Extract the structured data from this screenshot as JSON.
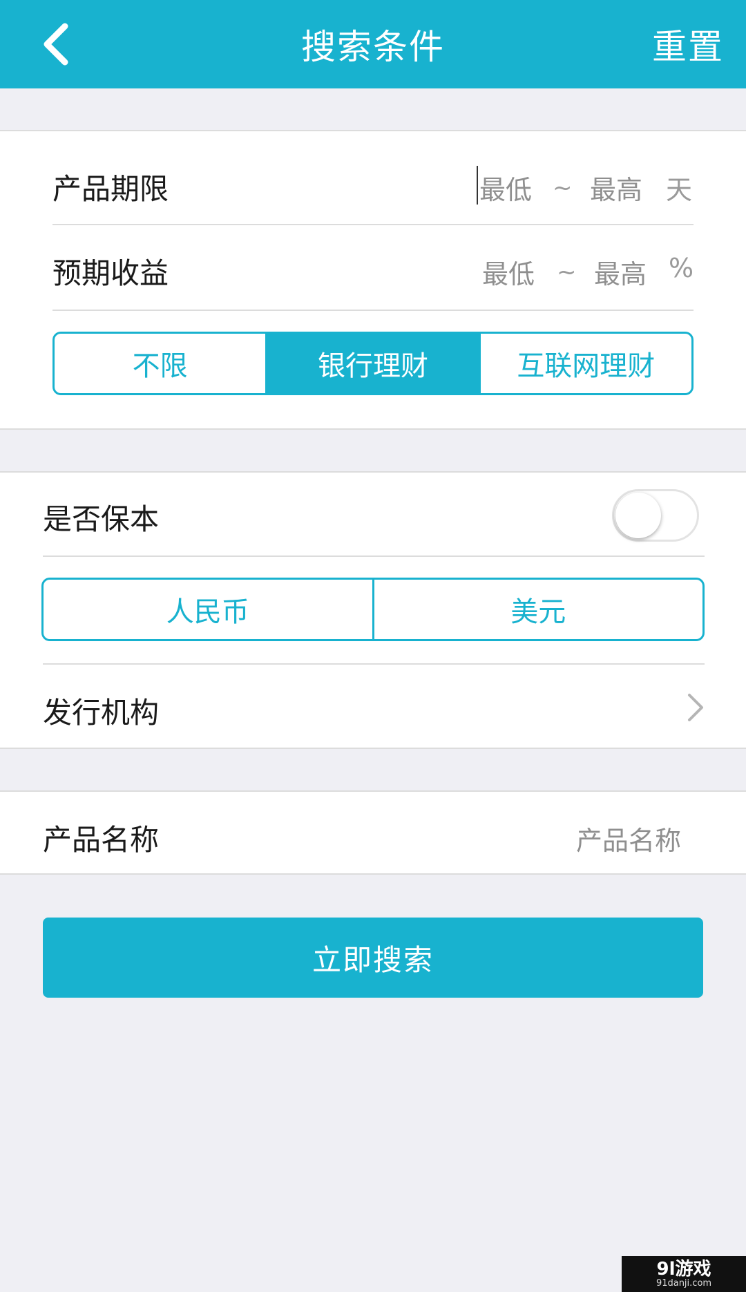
{
  "header": {
    "title": "搜索条件",
    "reset_label": "重置"
  },
  "term": {
    "label": "产品期限",
    "min_placeholder": "最低",
    "separator": "~",
    "max_placeholder": "最高",
    "unit": "天"
  },
  "yield": {
    "label": "预期收益",
    "min_placeholder": "最低",
    "separator": "~",
    "max_placeholder": "最高",
    "unit": "%"
  },
  "product_type": {
    "options": [
      "不限",
      "银行理财",
      "互联网理财"
    ],
    "selected": "银行理财"
  },
  "principal": {
    "label": "是否保本",
    "enabled": false
  },
  "currency": {
    "options": [
      "人民币",
      "美元"
    ]
  },
  "issuer": {
    "label": "发行机构"
  },
  "product_name": {
    "label": "产品名称",
    "placeholder": "产品名称"
  },
  "search_button": {
    "label": "立即搜索"
  },
  "watermark": {
    "main": "9l游戏",
    "sub": "91danji.com"
  },
  "colors": {
    "accent": "#18b2cf",
    "background": "#efeff4"
  }
}
